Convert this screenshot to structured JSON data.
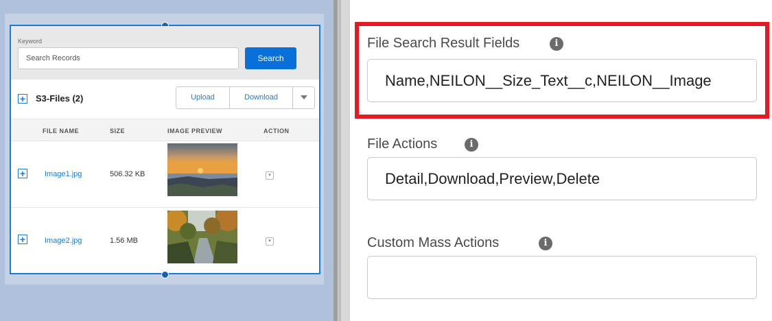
{
  "search": {
    "keyword_label": "Keyword",
    "placeholder": "Search Records",
    "button_label": "Search"
  },
  "files": {
    "title": "S3-Files (2)",
    "upload_label": "Upload",
    "download_label": "Download",
    "columns": [
      "FILE NAME",
      "SIZE",
      "IMAGE PREVIEW",
      "ACTION"
    ],
    "rows": [
      {
        "name": "Image1.jpg",
        "size": "506.32 KB"
      },
      {
        "name": "Image2.jpg",
        "size": "1.56 MB"
      }
    ]
  },
  "settings": {
    "search_fields": {
      "label": "File Search Result Fields",
      "value": "Name,NEILON__Size_Text__c,NEILON__Image"
    },
    "file_actions": {
      "label": "File Actions",
      "value": "Detail,Download,Preview,Delete"
    },
    "mass_actions": {
      "label": "Custom Mass Actions",
      "value": ""
    },
    "info_glyph": "i"
  },
  "colors": {
    "accent": "#1b7bd3",
    "highlight": "#e21b23",
    "canvas": "#b0c1dc"
  }
}
